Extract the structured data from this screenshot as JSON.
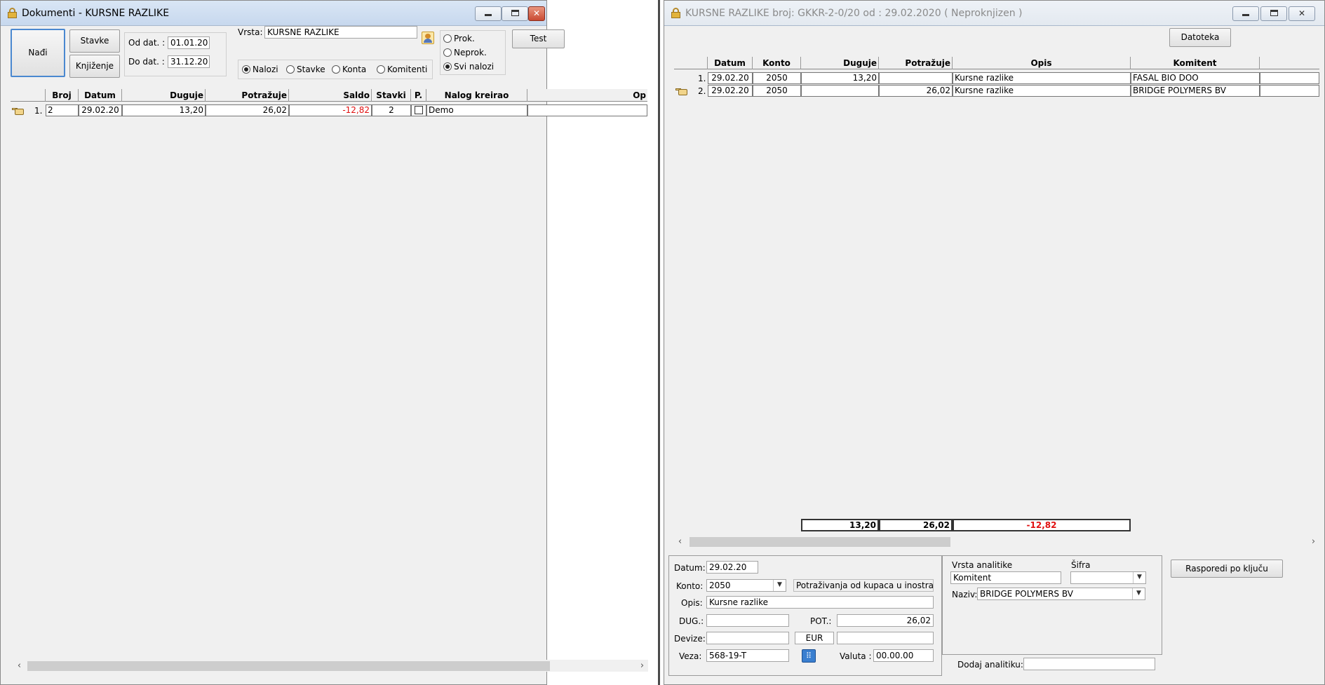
{
  "left_window": {
    "title": "Dokumenti - KURSNE RAZLIKE",
    "buttons": {
      "find": "Nađi",
      "items": "Stavke",
      "posting": "Knjiženje",
      "test": "Test"
    },
    "date_from_label": "Od dat. :",
    "date_from": "01.01.20",
    "date_to_label": "Do dat. :",
    "date_to": "31.12.20",
    "type_label": "Vrsta:",
    "type_value": "KURSNE RAZLIKE",
    "view_options": [
      "Nalozi",
      "Stavke",
      "Konta",
      "Komitenti"
    ],
    "view_selected": "Nalozi",
    "status_options": [
      "Prok.",
      "Neprok.",
      "Svi nalozi"
    ],
    "status_selected": "Svi nalozi",
    "columns": [
      "Broj",
      "Datum",
      "Duguje",
      "Potražuje",
      "Saldo",
      "Stavki",
      "P.",
      "Nalog kreirao",
      "Op"
    ],
    "rows": [
      {
        "num": "1.",
        "broj": "2",
        "datum": "29.02.20",
        "duguje": "13,20",
        "potrazuje": "26,02",
        "saldo": "-12,82",
        "stavki": "2",
        "p": false,
        "kreirao": "Demo",
        "op": ""
      }
    ]
  },
  "right_window": {
    "title": "KURSNE RAZLIKE broj: GKKR-2-0/20  od : 29.02.2020 ( Neproknjizen )",
    "file_button": "Datoteka",
    "columns": [
      "Datum",
      "Konto",
      "Duguje",
      "Potražuje",
      "Opis",
      "Komitent"
    ],
    "rows": [
      {
        "num": "1.",
        "datum": "29.02.20",
        "konto": "2050",
        "duguje": "13,20",
        "potrazuje": "",
        "opis": "Kursne razlike",
        "komitent": "FASAL BIO DOO"
      },
      {
        "num": "2.",
        "datum": "29.02.20",
        "konto": "2050",
        "duguje": "",
        "potrazuje": "26,02",
        "opis": "Kursne razlike",
        "komitent": "BRIDGE POLYMERS BV"
      }
    ],
    "totals": {
      "duguje": "13,20",
      "potrazuje": "26,02",
      "saldo": "-12,82"
    },
    "form": {
      "datum_label": "Datum:",
      "datum": "29.02.20",
      "konto_label": "Konto:",
      "konto": "2050",
      "konto_desc": "Potraživanja od kupaca u inostrans",
      "opis_label": "Opis:",
      "opis": "Kursne razlike",
      "dug_label": "DUG.:",
      "dug": "",
      "pot_label": "POT.:",
      "pot": "26,02",
      "devize_label": "Devize:",
      "devize": "",
      "currency": "EUR",
      "devize_amount": "",
      "veza_label": "Veza:",
      "veza": "568-19-T",
      "valuta_label": "Valuta :",
      "valuta": "00.00.00"
    },
    "analytics": {
      "type_label": "Vrsta analitike",
      "type_value": "Komitent",
      "code_label": "Šifra",
      "code_value": "",
      "name_label": "Naziv:",
      "name_value": "BRIDGE POLYMERS BV",
      "add_label": "Dodaj analitiku:",
      "add_value": ""
    },
    "distribute_button": "Rasporedi po ključu"
  }
}
